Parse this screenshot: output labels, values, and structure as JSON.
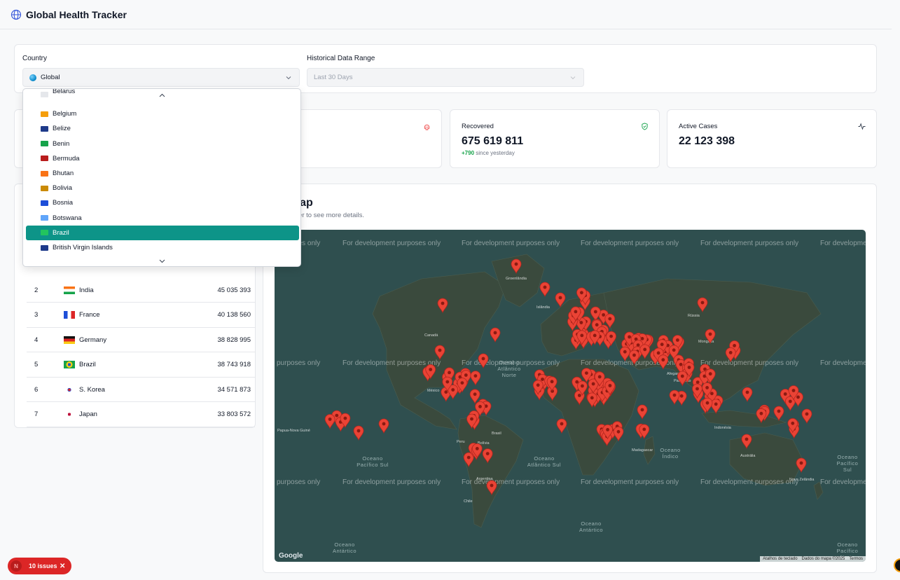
{
  "header": {
    "title": "Global Health Tracker",
    "icon": "globe-icon"
  },
  "filters": {
    "country_label": "Country",
    "country_value": "Global",
    "range_label": "Historical Data Range",
    "range_value": "Last 30 Days"
  },
  "stats": {
    "recovered": {
      "title": "Recovered",
      "value": "675 619 811",
      "delta": "+790",
      "delta_suffix": " since yesterday",
      "icon": "shield-check-icon",
      "color": "#16a34a"
    },
    "active": {
      "title": "Active Cases",
      "value": "22 123 398",
      "icon": "activity-icon"
    },
    "deaths_icon": {
      "icon": "skull-icon",
      "color": "#ef4444"
    }
  },
  "rankings": [
    {
      "rank": "2",
      "country": "India",
      "value": "45 035 393"
    },
    {
      "rank": "3",
      "country": "France",
      "value": "40 138 560"
    },
    {
      "rank": "4",
      "country": "Germany",
      "value": "38 828 995"
    },
    {
      "rank": "5",
      "country": "Brazil",
      "value": "38 743 918"
    },
    {
      "rank": "6",
      "country": "S. Korea",
      "value": "34 571 873"
    },
    {
      "rank": "7",
      "country": "Japan",
      "value": "33 803 572"
    }
  ],
  "map": {
    "title_visible": "al Map",
    "subtitle_visible": "a marker to see more details.",
    "watermark": "For development purposes only",
    "watermark_left": "purposes only",
    "watermark_right": "For developme",
    "oceans": [
      {
        "lines": [
          "Oceano",
          "Atlântico",
          "Norte"
        ]
      },
      {
        "lines": [
          "Oceano",
          "Pacífico Sul"
        ]
      },
      {
        "lines": [
          "Oceano",
          "Atlântico Sul"
        ]
      },
      {
        "lines": [
          "Oceano",
          "Índico"
        ]
      },
      {
        "lines": [
          "Oceano",
          "Antártico"
        ]
      },
      {
        "lines": [
          "Oceano",
          "Antártico"
        ]
      },
      {
        "lines": [
          "Oceano",
          "Pacífico",
          "Sul"
        ]
      },
      {
        "lines": [
          "Oceano",
          "Pacífico",
          "Norte"
        ]
      }
    ],
    "places": [
      "Groenlândia",
      "Islândia",
      "Canadá",
      "Rússia",
      "Mongólia",
      "México",
      "Brasil",
      "Bolívia",
      "Argentina",
      "Austrália",
      "Indonésia",
      "Madagascar",
      "Papua-Nova Guiné",
      "Afeganistão",
      "Paquistão",
      "Nova Zelândia",
      "Chile",
      "Peru"
    ],
    "footer": [
      "Atalhos de teclado",
      "Dados do mapa ©2025",
      "Termos"
    ],
    "google": "Google"
  },
  "dropdown": {
    "items": [
      {
        "label": "Belarus",
        "flag_color": "#e5e7eb"
      },
      {
        "label": "Belgium",
        "flag_color": "#f59e0b"
      },
      {
        "label": "Belize",
        "flag_color": "#1e3a8a"
      },
      {
        "label": "Benin",
        "flag_color": "#16a34a"
      },
      {
        "label": "Bermuda",
        "flag_color": "#b91c1c"
      },
      {
        "label": "Bhutan",
        "flag_color": "#f97316"
      },
      {
        "label": "Bolivia",
        "flag_color": "#ca8a04"
      },
      {
        "label": "Bosnia",
        "flag_color": "#1d4ed8"
      },
      {
        "label": "Botswana",
        "flag_color": "#60a5fa"
      },
      {
        "label": "Brazil",
        "flag_color": "#22c55e"
      },
      {
        "label": "British Virgin Islands",
        "flag_color": "#1e3a8a"
      }
    ],
    "selected": "Brazil"
  },
  "issues": {
    "label": "10 issues",
    "logo": "N"
  }
}
